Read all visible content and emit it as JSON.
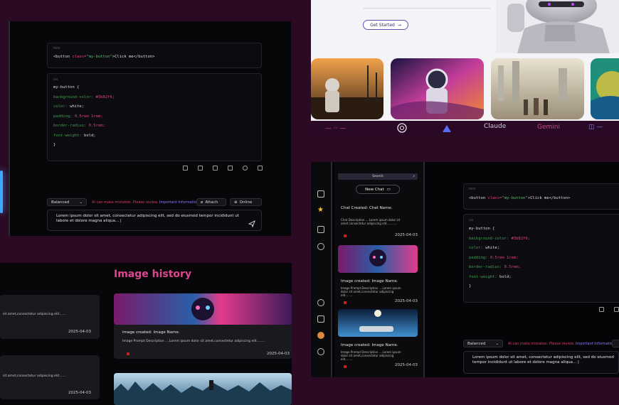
{
  "code_chat": {
    "html_tag": "html",
    "html_code": [
      "<button ",
      "class=",
      "\"my-button\"",
      ">Click me</button>"
    ],
    "css_tag": "css",
    "css_lines": [
      {
        "prop": "my-button {",
        "val": "",
        "kind": "plain"
      },
      {
        "prop": "background-color: ",
        "val": "#3b82f6;",
        "kind": "prop"
      },
      {
        "prop": "color: ",
        "val": "white;",
        "kind": "prop"
      },
      {
        "prop": "padding: ",
        "val": "0.5rem 1rem;",
        "kind": "prop"
      },
      {
        "prop": "border-radius: ",
        "val": "0.5rem;",
        "kind": "prop"
      },
      {
        "prop": "font-weight: ",
        "val": "bold;",
        "kind": "prop"
      },
      {
        "prop": "}",
        "val": "",
        "kind": "plain"
      }
    ],
    "model_select": "Balanced",
    "warning": "AI can make mistakes. Please review.",
    "warning_link": "Important Information",
    "attach_label": "Attach",
    "online_label": "Online",
    "input_text": "Lorem ipsum dolor sit amet, consectetur adipiscing elit, sed do eiusmod tempor incididunt ut labore et dolore magna aliqua... |"
  },
  "landing": {
    "get_started": "Get Started",
    "brands": [
      "OpenAI",
      "Claude",
      "Gemini"
    ]
  },
  "history": {
    "title": "Image history",
    "left_text": "sit amet,consectetur adipiscing elit.......",
    "left_dates": [
      "2025-04-03",
      "2025-04-03"
    ],
    "card_title": "Image created: Image Name.",
    "card_desc": "Image Prompt Description ....Lorem ipsum dolor sit amet,consectetur adipiscing elit........",
    "card_date": "2025-04-03"
  },
  "app": {
    "search_placeholder": "Search",
    "new_chat": "New Chat",
    "chat_title": "Chat Created: Chat Name.",
    "chat_desc": "Chat Description ....Lorem ipsum dolor sit amet consectetur adipiscing elit............",
    "chat_date": "2025-04-03",
    "img_title": "Image created: Image Name.",
    "img_desc": "Image Prompt Description ....Lorem ipsum dolor sit amet,consectetur adipiscing elit........",
    "img_date_1": "2025-04-03",
    "img_date_2": "2025-04-03",
    "model_select": "Balanced",
    "warning": "AI can make mistakes. Please review.",
    "warning_link": "Important Information.",
    "input_text": "Lorem ipsum dolor sit amet, consectetur adipiscing elit, sed do eiusmod tempor incididunt ut labore et dolore magna aliqua... |"
  }
}
